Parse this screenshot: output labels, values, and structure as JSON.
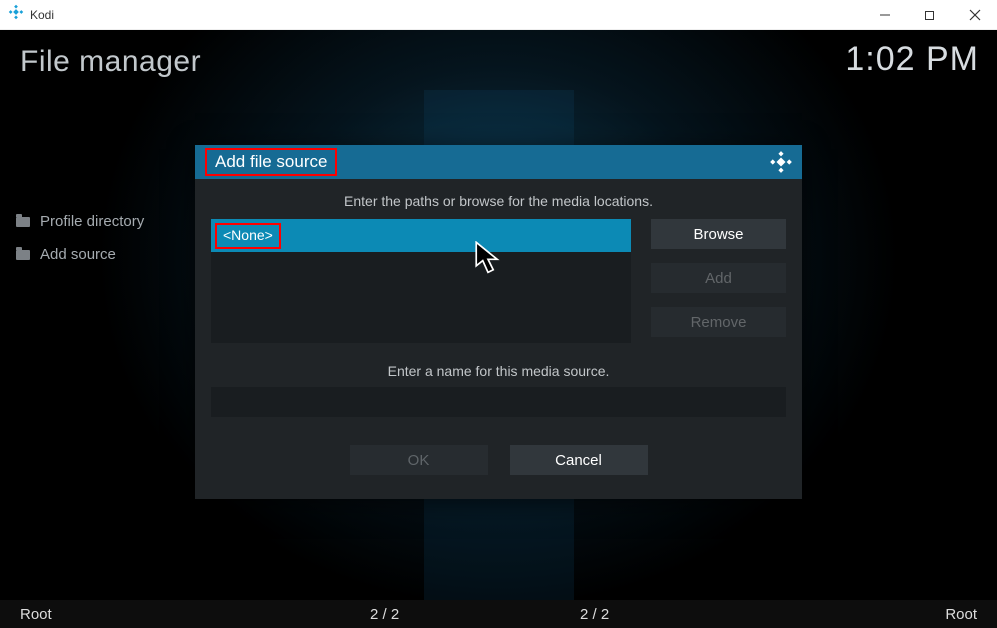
{
  "window": {
    "app_name": "Kodi"
  },
  "screen": {
    "title": "File manager",
    "clock": "1:02 PM"
  },
  "sidebar": {
    "items": [
      {
        "label": "Profile directory"
      },
      {
        "label": "Add source"
      }
    ]
  },
  "footer": {
    "left_label": "Root",
    "left_count": "2 / 2",
    "right_count": "2 / 2",
    "right_label": "Root"
  },
  "dialog": {
    "title": "Add file source",
    "instruction1": "Enter the paths or browse for the media locations.",
    "path_value": "<None>",
    "browse_label": "Browse",
    "add_label": "Add",
    "remove_label": "Remove",
    "instruction2": "Enter a name for this media source.",
    "name_value": "",
    "ok_label": "OK",
    "cancel_label": "Cancel"
  }
}
